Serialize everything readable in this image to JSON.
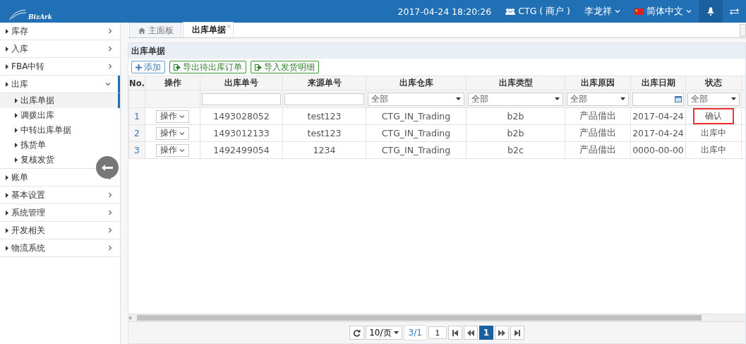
{
  "header": {
    "logo": "BizArk",
    "datetime": "2017-04-24 18:20:26",
    "merchant": "CTG ( 商户 )",
    "user": "李龙祥",
    "language": "简体中文"
  },
  "sidebar": {
    "items": [
      {
        "label": "库存",
        "expanded": false,
        "selected": false
      },
      {
        "label": "入库",
        "expanded": false,
        "selected": false
      },
      {
        "label": "FBA中转",
        "expanded": false,
        "selected": false
      },
      {
        "label": "出库",
        "expanded": true,
        "selected": true,
        "children": [
          {
            "label": "出库单据",
            "selected": true
          },
          {
            "label": "调拨出库",
            "selected": false
          },
          {
            "label": "中转出库单据",
            "selected": false
          },
          {
            "label": "拣货单",
            "selected": false
          },
          {
            "label": "复核发货",
            "selected": false
          }
        ]
      },
      {
        "label": "账单",
        "expanded": false,
        "selected": false
      },
      {
        "label": "基本设置",
        "expanded": false,
        "selected": false
      },
      {
        "label": "系统管理",
        "expanded": false,
        "selected": false
      },
      {
        "label": "开发相关",
        "expanded": false,
        "selected": false
      },
      {
        "label": "物流系统",
        "expanded": false,
        "selected": false
      }
    ]
  },
  "tabs": [
    {
      "label": "主面板",
      "kind": "home",
      "selected": false
    },
    {
      "label": "出库单据",
      "kind": "page",
      "selected": true,
      "close": "×"
    }
  ],
  "panel_title": "出库单据",
  "toolbar": [
    {
      "label": "添加",
      "kind": "add"
    },
    {
      "label": "导出待出库订单",
      "kind": "export"
    },
    {
      "label": "导入发货明细",
      "kind": "import"
    }
  ],
  "table": {
    "columns": [
      {
        "label": "No.",
        "filter": {
          "kind": "none"
        }
      },
      {
        "label": "操作",
        "filter": {
          "kind": "none"
        }
      },
      {
        "label": "出库单号",
        "filter": {
          "kind": "text"
        }
      },
      {
        "label": "来源单号",
        "filter": {
          "kind": "text"
        }
      },
      {
        "label": "出库仓库",
        "filter": {
          "kind": "select",
          "value": "全部"
        }
      },
      {
        "label": "出库类型",
        "filter": {
          "kind": "select",
          "value": "全部"
        }
      },
      {
        "label": "出库原因",
        "filter": {
          "kind": "select",
          "value": "全部"
        }
      },
      {
        "label": "出库日期",
        "filter": {
          "kind": "date"
        }
      },
      {
        "label": "状态",
        "filter": {
          "kind": "select",
          "value": "全部"
        }
      }
    ],
    "rows": [
      {
        "cells": [
          "1",
          "操作",
          "1493028052",
          "test123",
          "CTG_IN_Trading",
          "b2b",
          "产品借出",
          "2017-04-24",
          "确认"
        ],
        "status_flagged": true
      },
      {
        "cells": [
          "2",
          "操作",
          "1493012133",
          "test123",
          "CTG_IN_Trading",
          "b2b",
          "产品借出",
          "2017-04-24",
          "出库中"
        ],
        "status_flagged": false
      },
      {
        "cells": [
          "3",
          "操作",
          "1492499054",
          "1234",
          "CTG_IN_Trading",
          "b2c",
          "产品借出",
          "0000-00-00",
          "出库中"
        ],
        "status_flagged": false
      }
    ]
  },
  "pager": {
    "page_size": "10/页",
    "page_info": "3/1",
    "page_input": "1",
    "pages": [
      {
        "label": "1",
        "selected": true
      }
    ]
  }
}
